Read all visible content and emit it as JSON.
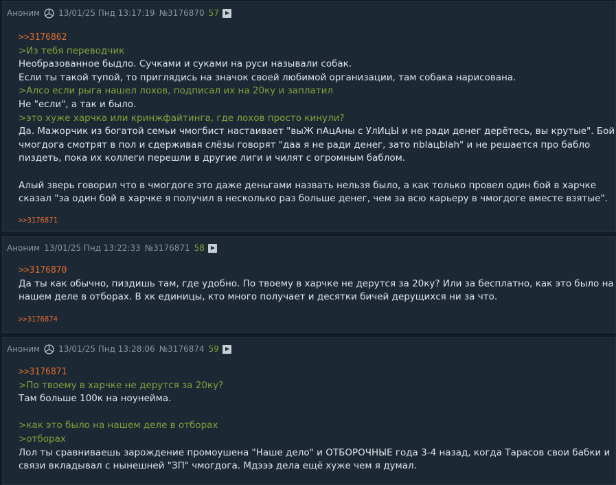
{
  "posts": [
    {
      "name": "Аноним",
      "has_emblem": true,
      "date": "13/01/25 Пнд 13:17:19",
      "number": "№3176870",
      "reply_count": "57",
      "lines": [
        {
          "type": "ref",
          "text": ">>3176862"
        },
        {
          "type": "quote",
          "text": ">Из тебя переводчик"
        },
        {
          "type": "text",
          "text": "Необразованное быдло. Сучками и суками на руси называли собак."
        },
        {
          "type": "text",
          "text": "Если ты такой тупой, то приглядись на значок своей любимой организации, там собака нарисована."
        },
        {
          "type": "quote",
          "text": ">Алсо если рыга нашел лохов, подписал их на 20ку и заплатил"
        },
        {
          "type": "text",
          "text": "Не \"если\", а так и было."
        },
        {
          "type": "quote",
          "text": ">это хуже харчка или кринжфайтинга, где лохов просто кинули?"
        },
        {
          "type": "text",
          "text": "Да. Мажорчик из богатой семьи чмогбист настаивает \"выЖ пАцАны с УлИцЫ и не ради денег дерётесь, вы крутые\". Бойцы"
        },
        {
          "type": "text",
          "text": "чмогдога смотрят в пол и сдерживая слёзы говорят \"даа я не ради денег, зато nblaцblah\" и не решается про бабло"
        },
        {
          "type": "text",
          "text": "пиздеть, пока их коллеги перешли в другие лиги и чилят с огромным баблом."
        },
        {
          "type": "blank",
          "text": ""
        },
        {
          "type": "text",
          "text": "Алый зверь говорил что в чмогдоге это даже деньгами назвать нельзя было, а как только провел один бой в харчке"
        },
        {
          "type": "text",
          "text": "сказал \"за один бой в харчке я получил в несколько раз больше денег, чем за всю карьеру в чмогдоге вместе взятые\"."
        }
      ],
      "replies": ">>3176871"
    },
    {
      "name": "Аноним",
      "has_emblem": false,
      "date": "13/01/25 Пнд 13:22:33",
      "number": "№3176871",
      "reply_count": "58",
      "lines": [
        {
          "type": "ref",
          "text": ">>3176870"
        },
        {
          "type": "text",
          "text": "Да ты как обычно, пиздишь там, где удобно. По твоему в харчке не дерутся за 20ку? Или за бесплатно, как это было на"
        },
        {
          "type": "text",
          "text": "нашем деле в отборах. В хк единицы, кто много получает и десятки бичей дерущихся ни за что."
        }
      ],
      "replies": ">>3176874"
    },
    {
      "name": "Аноним",
      "has_emblem": true,
      "date": "13/01/25 Пнд 13:28:06",
      "number": "№3176874",
      "reply_count": "59",
      "lines": [
        {
          "type": "ref",
          "text": ">>3176871"
        },
        {
          "type": "quote",
          "text": ">По твоему в харчке не дерутся за 20ку?"
        },
        {
          "type": "text",
          "text": "Там больше 100к на ноунейма."
        },
        {
          "type": "blank",
          "text": ""
        },
        {
          "type": "quote",
          "text": ">как это было на нашем деле в отборах"
        },
        {
          "type": "quote",
          "text": ">отборах"
        },
        {
          "type": "text",
          "text": "Лол ты сравниваешь зарождение промоушена \"Наше дело\" и ОТБОРОЧНЫЕ года 3-4 назад, когда Тарасов свои бабки и"
        },
        {
          "type": "text",
          "text": "связи вкладывал с нынешней \"ЗП\" чмогдога. Мдэээ дела ещё хуже чем я думал."
        }
      ],
      "replies": ""
    }
  ]
}
